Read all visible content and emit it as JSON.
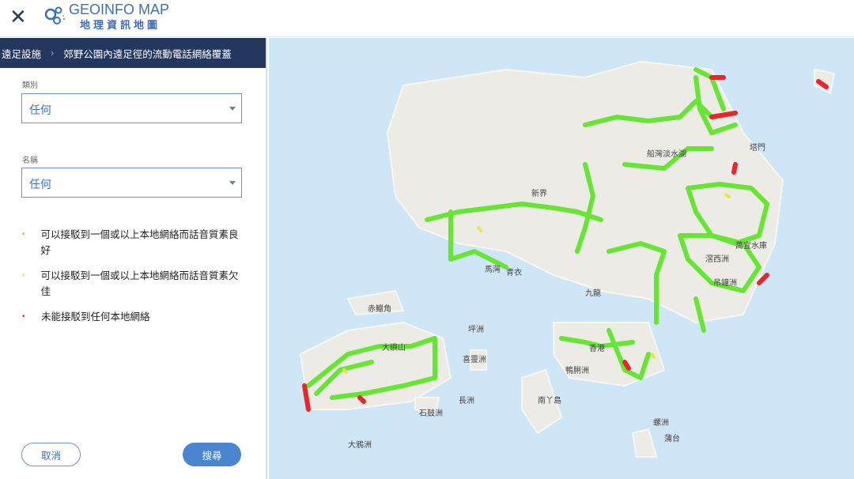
{
  "header": {
    "close_icon": "close-icon",
    "logo_en": "GEOINFO MAP",
    "logo_zh": "地理資訊地圖"
  },
  "breadcrumb": {
    "parent": "遠足設施",
    "separator": "›",
    "current": "郊野公園內遠足徑的流動電話網絡覆蓋"
  },
  "filters": {
    "category_label": "類別",
    "category_value": "任何",
    "name_label": "名稱",
    "name_value": "任何"
  },
  "legend": [
    {
      "text": "可以接駁到一個或以上本地網絡而話音質素良好",
      "color": "#66e633"
    },
    {
      "text": "可以接駁到一個或以上本地網絡而話音質素欠佳",
      "color": "#e8e84a"
    },
    {
      "text": "未能接駁到任何本地網絡",
      "color": "#e8262b"
    }
  ],
  "buttons": {
    "cancel": "取消",
    "search": "搜尋"
  },
  "map": {
    "labels": {
      "nt": "新界",
      "mawan": "馬灣",
      "tsingyi": "青衣",
      "kowloon": "九龍",
      "chek": "赤鱲角",
      "lantau": "大嶼山",
      "pengchau": "坪洲",
      "hei": "喜靈洲",
      "cheung": "長洲",
      "shekkwu": "石鼓洲",
      "soko": "大鴉洲",
      "lamma": "南丫島",
      "aplei": "鴨脷洲",
      "hk": "香港",
      "beaufort": "螺洲",
      "potoi": "蒲台",
      "tapmun": "塔門",
      "kausai": "滘西洲",
      "tiuchung": "吊鐘洲",
      "highisland": "萬宜水庫",
      "plover": "船灣淡水湖"
    },
    "colors": {
      "sea": "#cfe6f7",
      "land": "#ecebe6",
      "good": "#66e633",
      "poor": "#e8e84a",
      "none": "#e8262b"
    }
  }
}
